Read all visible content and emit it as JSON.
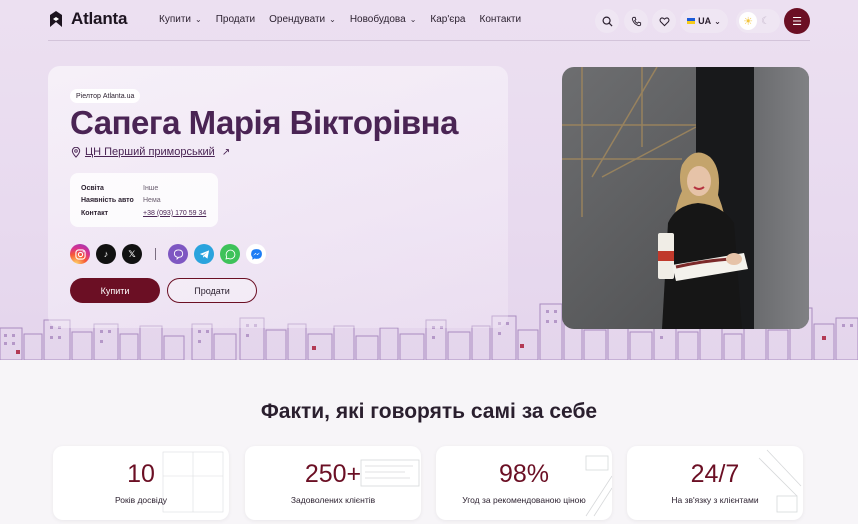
{
  "brand": {
    "name": "Atlanta"
  },
  "nav": [
    {
      "label": "Купити",
      "has_dropdown": true
    },
    {
      "label": "Продати",
      "has_dropdown": false
    },
    {
      "label": "Орендувати",
      "has_dropdown": true
    },
    {
      "label": "Новобудова",
      "has_dropdown": true
    },
    {
      "label": "Кар'єра",
      "has_dropdown": false
    },
    {
      "label": "Контакти",
      "has_dropdown": false
    }
  ],
  "header": {
    "language": "UA"
  },
  "profile": {
    "badge": "Ріелтор Atlanta.ua",
    "name": "Сапега Марія Вікторівна",
    "office": "ЦН Перший приморський",
    "details": [
      {
        "key": "Освіта",
        "value": "Інше"
      },
      {
        "key": "Наявність авто",
        "value": "Нема"
      },
      {
        "key": "Контакт",
        "value": "+38 (093) 170 59 34"
      }
    ],
    "buy_label": "Купити",
    "sell_label": "Продати"
  },
  "socials": [
    "instagram-icon",
    "tiktok-icon",
    "x-icon",
    "viber-icon",
    "telegram-icon",
    "whatsapp-icon",
    "messenger-icon"
  ],
  "facts": {
    "title": "Факти, які говорять самі за себе",
    "items": [
      {
        "value": "10",
        "label": "Років досвіду"
      },
      {
        "value": "250+",
        "label": "Задоволених клієнтів"
      },
      {
        "value": "98%",
        "label": "Угод за рекомендованою ціною"
      },
      {
        "value": "24/7",
        "label": "На зв'язку з клієнтами"
      }
    ]
  },
  "colors": {
    "accent": "#6b0f24",
    "name": "#4a2454",
    "hero_bg": "#e8daef"
  }
}
